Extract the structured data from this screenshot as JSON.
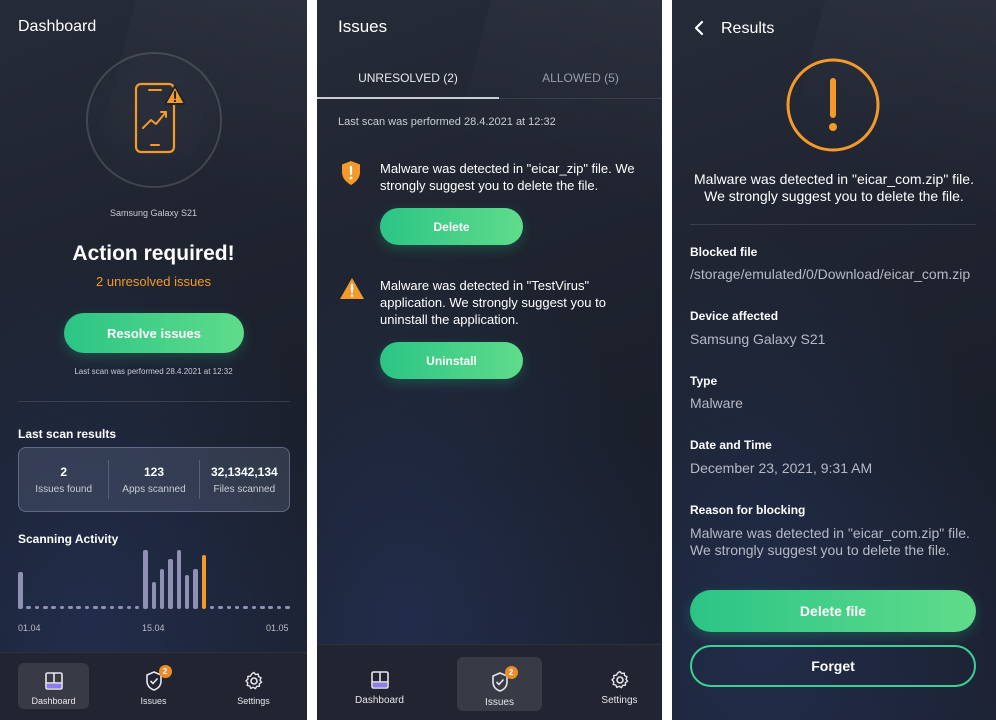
{
  "dashboard": {
    "title": "Dashboard",
    "device_name": "Samsung Galaxy S21",
    "heading": "Action required!",
    "unresolved": "2 unresolved issues",
    "resolve_button": "Resolve issues",
    "last_scan": "Last scan was performed 28.4.2021 at 12:32",
    "results_title": "Last scan results",
    "stats": [
      {
        "value": "2",
        "label": "Issues found",
        "color": "#f39a2b"
      },
      {
        "value": "123",
        "label": "Apps scanned"
      },
      {
        "value": "32,1342,134",
        "label": "Files scanned"
      }
    ],
    "activity_title": "Scanning Activity",
    "activity_levels": [
      0.62,
      0.05,
      0.05,
      0.05,
      0.05,
      0.05,
      0.05,
      0.05,
      0.05,
      0.05,
      0.05,
      0.05,
      0.05,
      0.05,
      0.05,
      1.0,
      0.45,
      0.68,
      0.85,
      1.0,
      0.58,
      0.68,
      0.92,
      0.05,
      0.05,
      0.05,
      0.05,
      0.05,
      0.05,
      0.05,
      0.05,
      0.05,
      0.05
    ],
    "activity_highlight_index": 22,
    "axis_labels": [
      "01.04",
      "15.04",
      "01.05"
    ]
  },
  "nav": {
    "dashboard": "Dashboard",
    "issues": "Issues",
    "settings": "Settings",
    "issues_badge": "2"
  },
  "issues": {
    "title": "Issues",
    "tab_unresolved": "UNRESOLVED (2)",
    "tab_allowed": "ALLOWED (5)",
    "last_scan": "Last scan was performed 28.4.2021 at 12:32",
    "items": [
      {
        "text": "Malware was detected in \"eicar_zip\" file. We strongly suggest you to delete the file.",
        "button": "Delete"
      },
      {
        "text": "Malware was detected in \"TestVirus\" application. We strongly suggest you to uninstall the application.",
        "button": "Uninstall"
      }
    ]
  },
  "results": {
    "title": "Results",
    "summary": "Malware was detected in \"eicar_com.zip\" file. We strongly suggest you to delete the file.",
    "details": [
      {
        "label": "Blocked file",
        "value": "/storage/emulated/0/Download/eicar_com.zip"
      },
      {
        "label": "Device affected",
        "value": "Samsung Galaxy S21"
      },
      {
        "label": "Type",
        "value": "Malware"
      },
      {
        "label": "Date and Time",
        "value": "December 23, 2021, 9:31 AM"
      },
      {
        "label": "Reason for blocking",
        "value": "Malware was detected in \"eicar_com.zip\" file. We strongly suggest you to delete the file."
      }
    ],
    "delete_button": "Delete file",
    "forget_button": "Forget"
  },
  "colors": {
    "accent_green": "#2cc486",
    "warning_orange": "#f39a2b",
    "background": "#1f2430"
  }
}
